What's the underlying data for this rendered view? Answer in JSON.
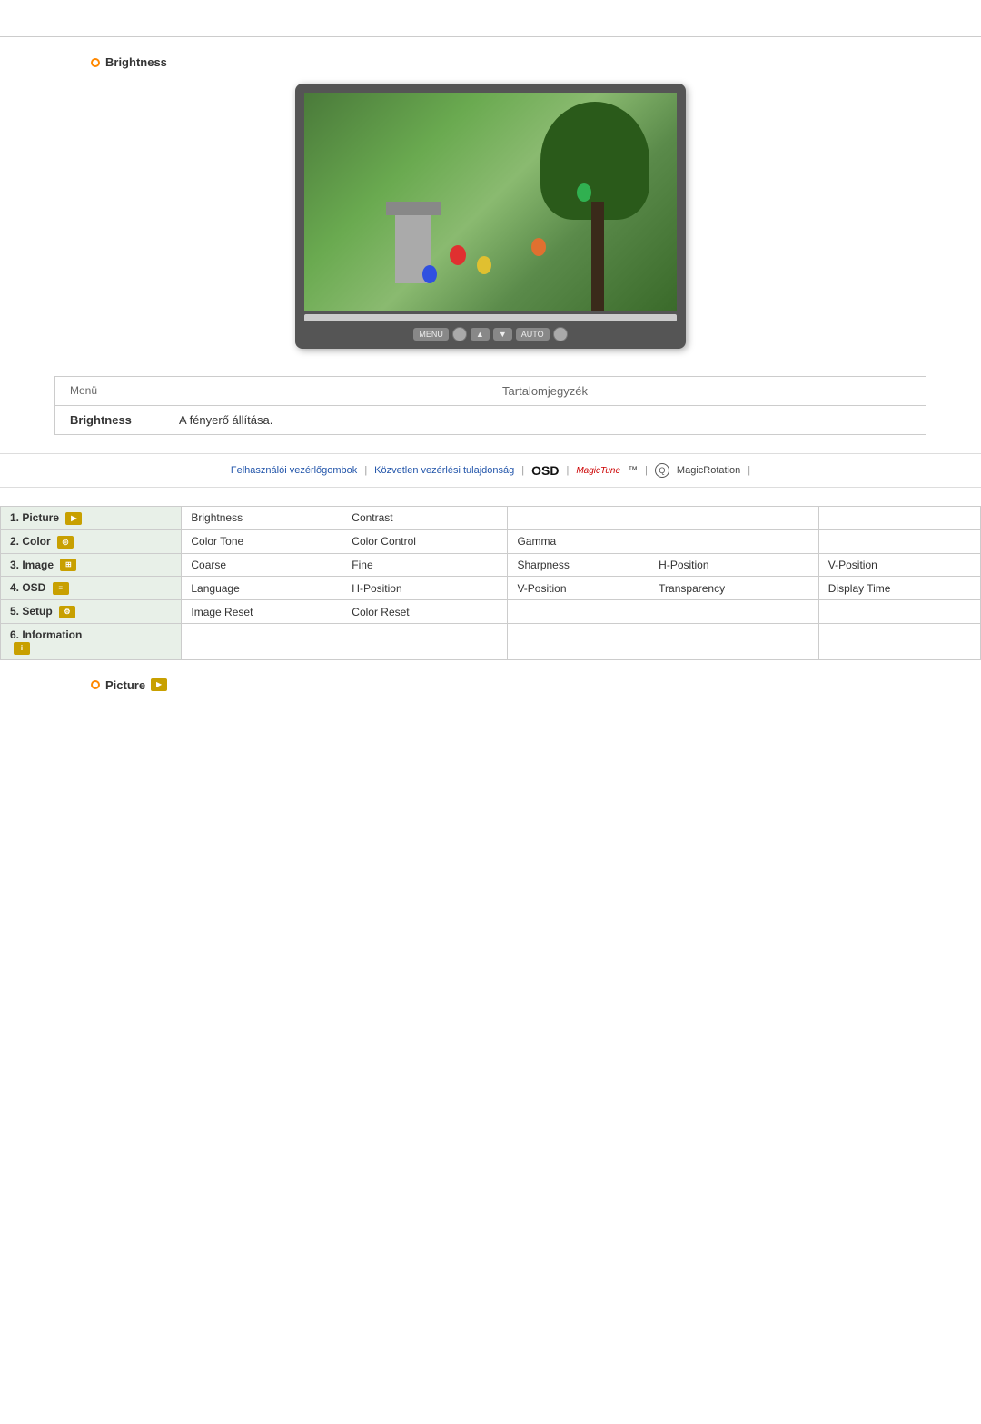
{
  "page": {
    "top_divider": true
  },
  "brightness_section": {
    "heading": "Brightness",
    "circle_icon": "○"
  },
  "monitor": {
    "controls": [
      "MENU",
      "◄▲",
      "▼►",
      "AUTO",
      "○"
    ]
  },
  "menu_table": {
    "header_menu": "Menü",
    "header_content": "Tartalomjegyzék",
    "row_label": "Brightness",
    "row_desc": "A fényerő állítása."
  },
  "nav_bar": {
    "link1": "Felhasználói vezérlőgombok",
    "sep1": "|",
    "link2": "Közvetlen vezérlési tulajdonság",
    "sep2": "|",
    "osd_label": "OSD",
    "sep3": "|",
    "magictune_logo": "MagicTune™",
    "sep4": "|",
    "rotation_icon": "Q",
    "magicrotation_label": "MagicRotation",
    "sep5": "|"
  },
  "osd_table": {
    "rows": [
      {
        "nav_item": "1. Picture",
        "nav_icon": "▶",
        "sub_items": [
          "Brightness",
          "Contrast",
          "",
          "",
          ""
        ]
      },
      {
        "nav_item": "2. Color",
        "nav_icon": "◎",
        "sub_items": [
          "Color Tone",
          "Color Control",
          "Gamma",
          "",
          ""
        ]
      },
      {
        "nav_item": "3. Image",
        "nav_icon": "⊞",
        "sub_items": [
          "Coarse",
          "Fine",
          "Sharpness",
          "H-Position",
          "V-Position"
        ]
      },
      {
        "nav_item": "4. OSD",
        "nav_icon": "≡",
        "sub_items": [
          "Language",
          "H-Position",
          "V-Position",
          "Transparency",
          "Display Time"
        ]
      },
      {
        "nav_item": "5. Setup",
        "nav_icon": "⚙",
        "sub_items": [
          "Image Reset",
          "Color Reset",
          "",
          "",
          ""
        ]
      },
      {
        "nav_item": "6. Information",
        "nav_icon": "i",
        "sub_items": [
          "",
          "",
          "",
          "",
          ""
        ]
      }
    ]
  },
  "picture_section": {
    "heading": "Picture",
    "icon_text": "▶"
  }
}
